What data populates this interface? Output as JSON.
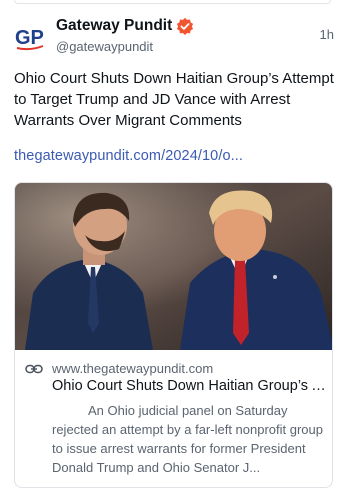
{
  "post": {
    "author_name": "Gateway Pundit",
    "author_handle": "@gatewaypundit",
    "timestamp": "1h",
    "avatar_text": "GP",
    "text": "Ohio Court Shuts Down Haitian Group’s Attempt to Target Trump and JD Vance with Arrest Warrants Over Migrant Comments",
    "link": "thegatewaypundit.com/2024/10/o..."
  },
  "card": {
    "domain": "www.thegatewaypundit.com",
    "title": "Ohio Court Shuts Down Haitian Group’s Attempt to Target Trump and JD Vance with Arrest Warrants Over Migrant Comments",
    "description": "An Ohio judicial panel on Saturday rejected an attempt by a far-left nonprofit group to issue arrest warrants for former President Donald Trump and Ohio Senator J...",
    "image_icon": "photo-two-men-suits-icon"
  },
  "colors": {
    "link": "#3b5bb3",
    "verified": "#f0562f",
    "muted": "#5b6470",
    "text": "#0f1419"
  }
}
